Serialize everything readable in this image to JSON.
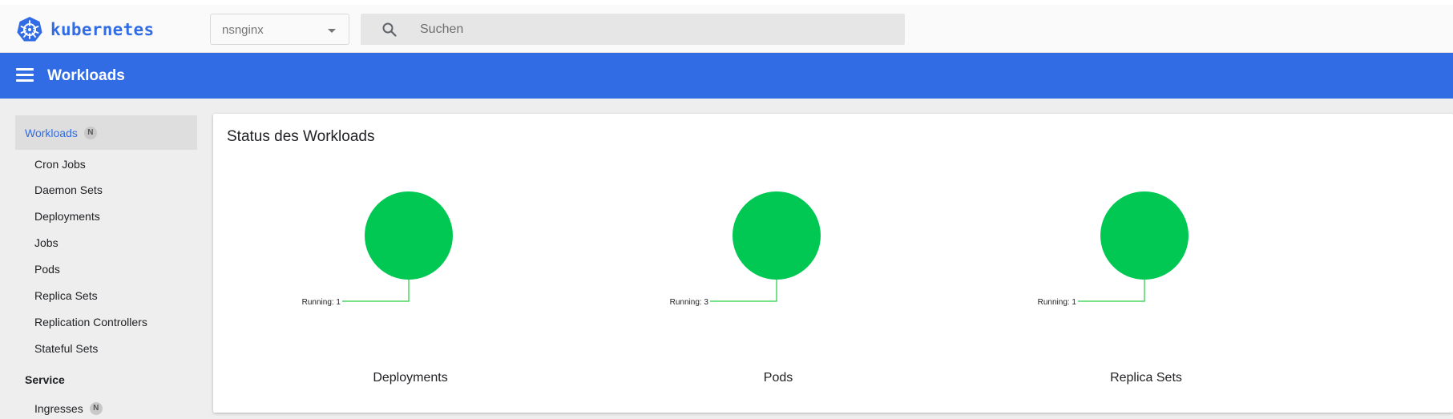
{
  "header": {
    "brand": "kubernetes",
    "namespace": {
      "selected": "nsnginx"
    },
    "search": {
      "placeholder": "Suchen"
    }
  },
  "toolbar": {
    "title": "Workloads"
  },
  "sidebar": {
    "head": {
      "label": "Workloads",
      "badge": "N"
    },
    "items": [
      {
        "label": "Cron Jobs"
      },
      {
        "label": "Daemon Sets"
      },
      {
        "label": "Deployments"
      },
      {
        "label": "Jobs"
      },
      {
        "label": "Pods"
      },
      {
        "label": "Replica Sets"
      },
      {
        "label": "Replication Controllers"
      },
      {
        "label": "Stateful Sets"
      }
    ],
    "section": {
      "label": "Service"
    },
    "section_items": [
      {
        "label": "Ingresses",
        "badge": "N"
      }
    ]
  },
  "card": {
    "title": "Status des Workloads"
  },
  "colors": {
    "brand": "#326ce5",
    "running": "#00c853",
    "leader": "#4cd964"
  },
  "chart_data": [
    {
      "type": "pie",
      "title": "Deployments",
      "slices": [
        {
          "label": "Running",
          "value": 1
        }
      ],
      "slice_labels": [
        "Running: 1"
      ]
    },
    {
      "type": "pie",
      "title": "Pods",
      "slices": [
        {
          "label": "Running",
          "value": 3
        }
      ],
      "slice_labels": [
        "Running: 3"
      ]
    },
    {
      "type": "pie",
      "title": "Replica Sets",
      "slices": [
        {
          "label": "Running",
          "value": 1
        }
      ],
      "slice_labels": [
        "Running: 1"
      ]
    }
  ]
}
